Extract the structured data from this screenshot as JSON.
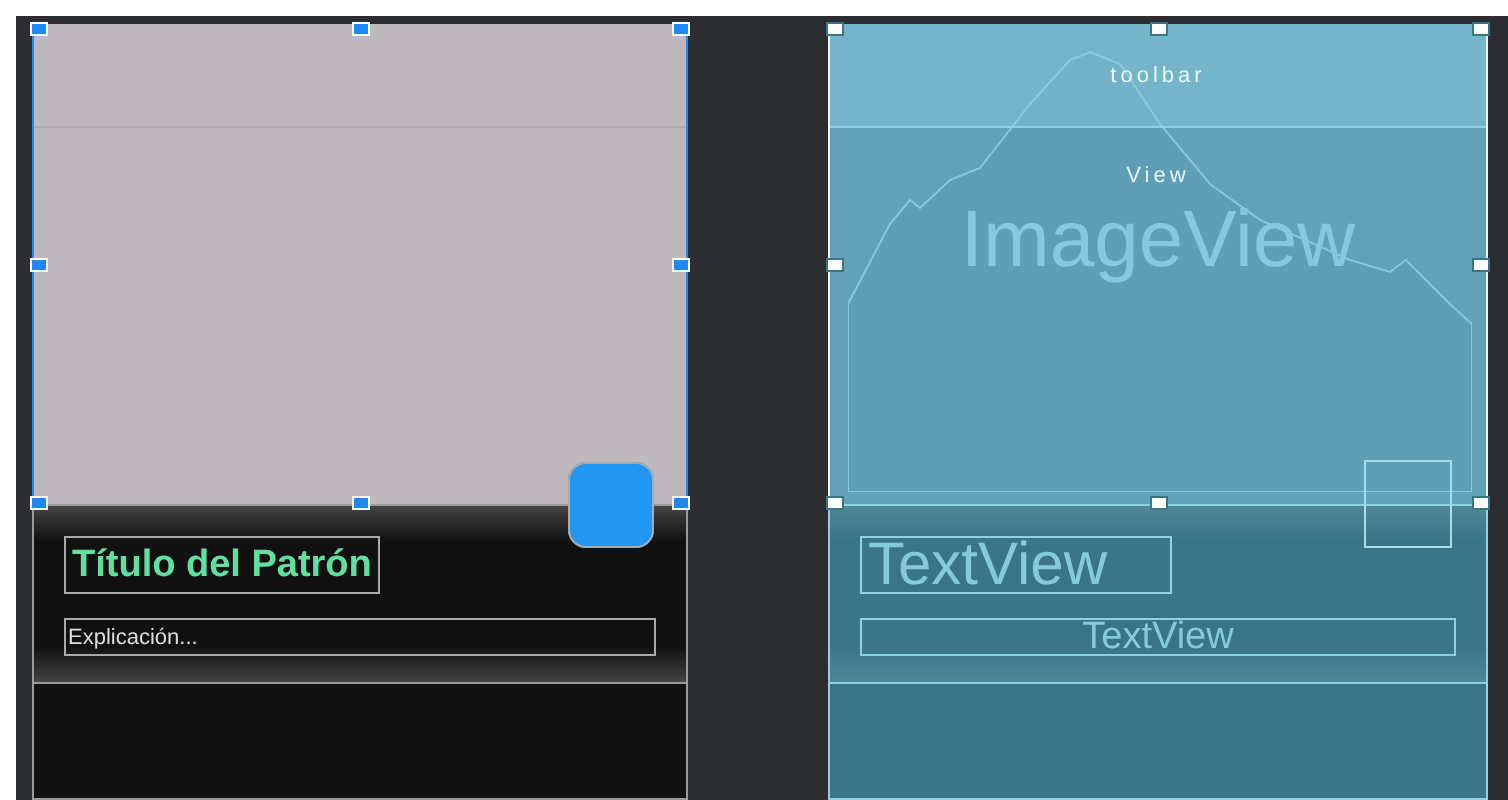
{
  "design": {
    "image_view": {
      "selected": true
    },
    "title": "Título del Patrón",
    "explanation": "Explicación..."
  },
  "blueprint": {
    "image_view": {
      "selected": true
    },
    "toolbar_label": "toolbar",
    "view_label": "View",
    "image_label": "ImageView",
    "title_label": "TextView",
    "explanation_label": "TextView"
  }
}
